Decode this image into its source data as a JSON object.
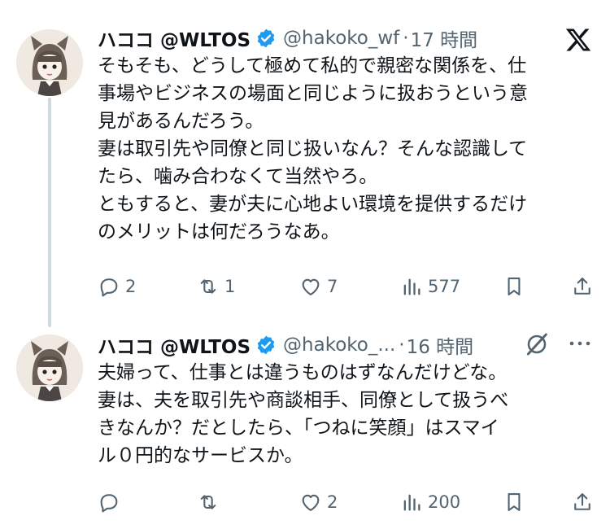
{
  "tweets": [
    {
      "name": "ハココ @WLTOS",
      "handle": "@hakoko_wf",
      "separator": "·",
      "time": "17 時間",
      "lines": [
        "そもそも、どうして極めて私的で親密な関係を、仕",
        "事場やビジネスの場面と同じように扱おうという意",
        "見があるんだろう。",
        "妻は取引先や同僚と同じ扱いなん？そんな認識して",
        "たら、噛み合わなくて当然やろ。",
        "ともすると、妻が夫に心地よい環境を提供するだけ",
        "のメリットは何だろうなあ。"
      ],
      "actions": {
        "replies": "2",
        "reposts": "1",
        "likes": "7",
        "views": "577"
      }
    },
    {
      "name": "ハココ @WLTOS",
      "handle": "@hakoko_...",
      "separator": "·",
      "time": "16 時間",
      "lines": [
        "夫婦って、仕事とは違うものはずなんだけどな。",
        "妻は、夫を取引先や商談相手、同僚として扱うべ",
        "きなんか？だとしたら、「つねに笑顔」はスマイ",
        "ル０円的なサービスか。"
      ],
      "actions": {
        "replies": "",
        "reposts": "",
        "likes": "2",
        "views": "200"
      }
    }
  ],
  "icons": {
    "verified": "verified-badge-icon",
    "x_logo": "x-logo-icon",
    "grok": "grok-icon",
    "more": "more-icon",
    "reply": "reply-icon",
    "repost": "repost-icon",
    "like": "like-icon",
    "views": "views-icon",
    "bookmark": "bookmark-icon",
    "share": "share-icon"
  },
  "colors": {
    "text": "#0f1419",
    "secondary": "#536471",
    "verified": "#1d9bf0",
    "thread_line": "#cfd9de"
  }
}
